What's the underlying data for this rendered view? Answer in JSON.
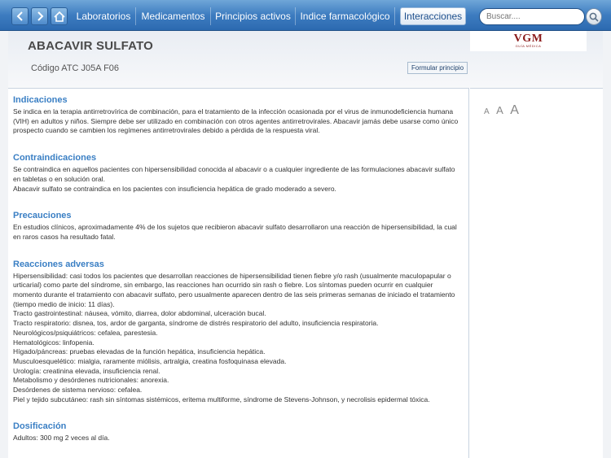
{
  "nav": {
    "back_icon": "chevron-left-icon",
    "forward_icon": "chevron-right-icon",
    "home_icon": "home-icon",
    "tabs": [
      {
        "label": "Laboratorios",
        "active": false
      },
      {
        "label": "Medicamentos",
        "active": false
      },
      {
        "label": "Principios activos",
        "active": false
      },
      {
        "label": "Indice farmacológico",
        "active": false
      },
      {
        "label": "Interacciones",
        "active": true
      }
    ],
    "search_placeholder": "Buscar....",
    "search_icon": "search-icon"
  },
  "header": {
    "title": "ABACAVIR SULFATO",
    "atc": "Código ATC J05A F06",
    "formular_button": "Formular principio",
    "logo_text": "VGM",
    "logo_sub": "GUÍA MÉDICA"
  },
  "font_size_controls": [
    "A",
    "A",
    "A"
  ],
  "sections": [
    {
      "heading": "Indicaciones",
      "body": "Se indica en la terapia antirretrovírica de combinación, para el tratamiento de la infección ocasionada por el virus de inmunodeficiencia humana (VIH) en adultos y niños. Siempre debe ser utilizado en combinación con otros agentes antirretrovirales. Abacavir jamás debe usarse como único prospecto cuando se cambien los regímenes antirretrovirales debido a pérdida de la respuesta viral."
    },
    {
      "heading": "Contraindicaciones",
      "body": "Se contraindica en aquellos pacientes con hipersensibilidad conocida al abacavir o a cualquier ingrediente de las formulaciones abacavir sulfato en tabletas o en solución oral.\nAbacavir sulfato se contraindica en los pacientes con insuficiencia hepática de grado moderado a severo."
    },
    {
      "heading": "Precauciones",
      "body": "En estudios clínicos, aproximadamente 4% de los sujetos que recibieron abacavir sulfato desarrollaron una reacción de hipersensibilidad, la cual en raros casos ha resultado fatal."
    },
    {
      "heading": "Reacciones adversas",
      "body": "Hipersensibilidad: casi todos los pacientes que desarrollan reacciones de hipersensibilidad tienen fiebre y/o rash (usualmente maculopapular o urticarial) como parte del síndrome, sin embargo, las reacciones han ocurrido sin rash o fiebre. Los síntomas pueden ocurrir en cualquier momento durante el tratamiento con abacavir sulfato, pero usualmente aparecen dentro de las seis primeras semanas de iniciado el tratamiento (tiempo medio de inicio: 11 días).\nTracto gastrointestinal: náusea, vómito, diarrea, dolor abdominal, ulceración bucal.\nTracto respiratorio: disnea, tos, ardor de garganta, síndrome de distrés respiratorio del adulto, insuficiencia respiratoria.\nNeurológicos/psiquiátricos: cefalea, parestesia.\nHematológicos: linfopenia.\nHígado/páncreas: pruebas elevadas de la función hepática, insuficiencia hepática.\nMusculoesquelético: mialgia, raramente miólisis, artralgia, creatina fosfoquinasa elevada.\nUrología: creatinina elevada, insuficiencia renal.\nMetabolismo y desórdenes nutricionales: anorexia.\nDesórdenes de sistema nervioso: cefalea.\nPiel y tejido subcutáneo: rash sin síntomas sistémicos, eritema multiforme, síndrome de Stevens-Johnson, y necrolisis epidermal tóxica."
    },
    {
      "heading": "Dosificación",
      "body": "Adultos: 300 mg 2 veces al día."
    }
  ],
  "colors": {
    "nav_bar": "#3d7cc0",
    "section_heading": "#3a7fc4",
    "logo": "#8b1a1a"
  }
}
